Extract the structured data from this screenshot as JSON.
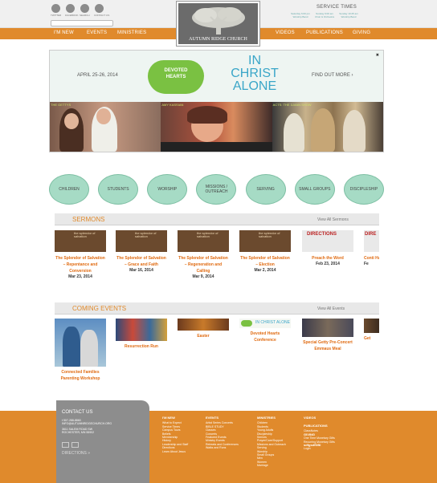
{
  "social": [
    {
      "icon": "twitter-icon",
      "label": "TWITTER"
    },
    {
      "icon": "facebook-icon",
      "label": "FACEBOOK"
    },
    {
      "icon": "search-icon",
      "label": "SEARCH"
    },
    {
      "icon": "contact-icon",
      "label": "CONTACT US"
    }
  ],
  "service_times": {
    "title": "SERVICE TIMES",
    "items": [
      {
        "time": "Saturday 6:00 pm",
        "label": "Worship Band"
      },
      {
        "time": "Sunday 9:00 am",
        "label": "Choir & Orchestra"
      },
      {
        "time": "Sunday 10:45 am",
        "label": "Worship Band"
      }
    ]
  },
  "nav": {
    "left": [
      "I'M NEW",
      "EVENTS",
      "MINISTRIES"
    ],
    "right": [
      "VIDEOS",
      "PUBLICATIONS",
      "GIVING"
    ]
  },
  "logo": {
    "text": "AUTUMN RIDGE CHURCH"
  },
  "banner": {
    "date": "APRIL 25-26, 2014",
    "badge_line1": "DEVOTED",
    "badge_line2": "HEARTS",
    "title_line1": "IN",
    "title_line2": "CHRIST",
    "title_line3": "ALONE",
    "find_more": "FIND OUT MORE ›",
    "close": "✖",
    "photo_captions": [
      "THE GETTYS",
      "AMY KASSIAN",
      "ACTS: THE 3-MAN SHOW"
    ]
  },
  "categories": [
    "CHILDREN",
    "STUDENTS",
    "WORSHIP",
    "MISSIONS / OUTREACH",
    "SERVING",
    "SMALL GROUPS",
    "DISCIPLESHIP"
  ],
  "sermons": {
    "heading": "SERMONS",
    "view_all": "View All Sermons",
    "items": [
      {
        "img": "the splendor of salvation",
        "title": "The Splendor of Salvation – Repentance and Conversion",
        "date": "Mar 23, 2014"
      },
      {
        "img": "the splendor of salvation",
        "title": "The Splendor of Salvation – Grace and Faith",
        "date": "Mar 16, 2014"
      },
      {
        "img": "the splendor of salvation",
        "title": "The Splendor of Salvation – Regeneration and Calling",
        "date": "Mar 9, 2014"
      },
      {
        "img": "the splendor of salvation",
        "title": "The Splendor of Salvation – Election",
        "date": "Mar 2, 2014"
      },
      {
        "img": "DIRECTIONS",
        "title": "Preach the Word",
        "date": "Feb 23, 2014"
      },
      {
        "img": "DIRE",
        "title": "Conti Ha",
        "date": "Fe"
      }
    ]
  },
  "events": {
    "heading": "COMING EVENTS",
    "view_all": "View All Events",
    "items": [
      {
        "title": "Connected Families Parenting Workshop"
      },
      {
        "title": "Resurrection Run"
      },
      {
        "title": "Easter"
      },
      {
        "title": "Devoted Hearts Conference",
        "img": "IN CHRIST ALONE"
      },
      {
        "title": "Special Getty Pre-Concert Emmaus Meal"
      },
      {
        "title": "Get"
      }
    ]
  },
  "footer": {
    "contact_heading": "CONTACT US",
    "phone": "t 507-288-8860",
    "email": "INFO@AUTUMNRIDGECHURCH.ORG",
    "addr1": "3611 SALEM ROAD SW",
    "addr2": "ROCHESTER, MN 55902",
    "directions": "DIRECTIONS »",
    "columns": [
      {
        "heading": "I'M NEW",
        "links": [
          "What to Expect",
          "Service Times",
          "Campus Tours",
          "Beliefs",
          "Membership",
          "History",
          "Leadership and Staff",
          "Directions",
          "Learn About Jesus"
        ]
      },
      {
        "heading": "EVENTS",
        "links": [
          "Artist Series Concerts",
          "BIBLE STUDY",
          "Classes",
          "Concerts",
          "Featured Events",
          "Ministry Events",
          "Retreats and Conferences",
          "Walks and Runs"
        ]
      },
      {
        "heading": "MINISTRIES",
        "links": [
          "Children",
          "Students",
          "Young Adults",
          "Discipleship",
          "Seniors",
          "Prayer/Care/Support",
          "Missions and Outreach",
          "Serving",
          "Worship",
          "Small Groups",
          "Men",
          "Women",
          "Marriage"
        ]
      },
      {
        "heading": "VIDEOS",
        "links": []
      },
      {
        "heading": "PUBLICATIONS",
        "links": [
          "ClassNotes",
          "",
          "GIVING",
          "One Time Monetary Gifts",
          "Recurring Monetary Gifts",
          "",
          "sdfgsdfDBI",
          "Login"
        ]
      }
    ]
  }
}
